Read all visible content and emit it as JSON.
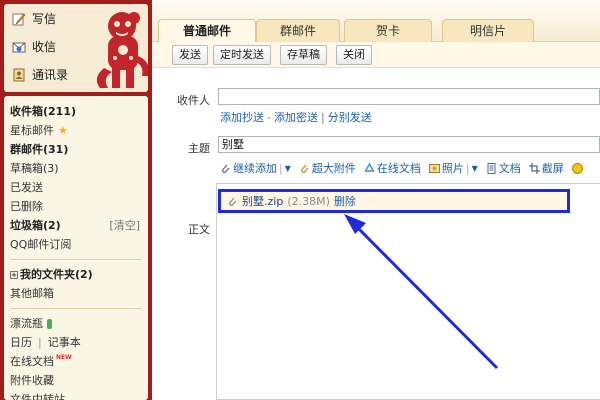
{
  "sidebar": {
    "top_links": {
      "write": "写信",
      "inbox": "收信",
      "contacts": "通讯录"
    },
    "folders": [
      {
        "label": "收件箱(211)"
      },
      {
        "label": "星标邮件"
      },
      {
        "label": "群邮件(31)"
      },
      {
        "label": "草稿箱(3)"
      },
      {
        "label": "已发送"
      },
      {
        "label": "已删除"
      },
      {
        "label": "垃圾箱(2)",
        "action": "[清空]"
      },
      {
        "label": "QQ邮件订阅"
      },
      {
        "label": "我的文件夹(2)"
      },
      {
        "label": "其他邮箱"
      },
      {
        "label": "漂流瓶"
      },
      {
        "label": "日历",
        "label2": "记事本"
      },
      {
        "label": "在线文档",
        "badge": "NEW"
      },
      {
        "label": "附件收藏"
      },
      {
        "label": "文件中转站"
      }
    ]
  },
  "tabs": [
    {
      "label": "普通邮件"
    },
    {
      "label": "群邮件"
    },
    {
      "label": "贺卡"
    },
    {
      "label": "明信片"
    }
  ],
  "toolbar": {
    "send": "发送",
    "scheduled_send": "定时发送",
    "save_draft": "存草稿",
    "close": "关闭"
  },
  "compose": {
    "to_label": "收件人",
    "to_value": "",
    "cc_links": [
      "添加抄送",
      "添加密送",
      "分别发送"
    ],
    "subject_label": "主题",
    "subject_value": "别墅",
    "body_label": "正文"
  },
  "attach_toolbar": {
    "continue_add": "继续添加",
    "large_attach": "超大附件",
    "online_doc": "在线文档",
    "photo": "照片",
    "document": "文档",
    "screenshot": "截屏"
  },
  "attachment": {
    "filename": "别墅.zip",
    "size": "(2.38M)",
    "delete": "删除"
  },
  "colors": {
    "sidebar_red": "#a31d1d",
    "highlight_blue": "#1f2bd8",
    "link_blue": "#1f5fa8"
  }
}
